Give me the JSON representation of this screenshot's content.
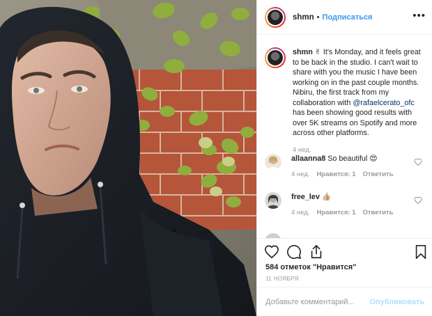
{
  "post": {
    "author": "shmn",
    "follow_separator": "•",
    "follow_label": "Подписаться",
    "more_icon": "ellipsis-icon"
  },
  "caption": {
    "author": "shmn",
    "emoji": "✌",
    "text_before": " It's Monday, and it feels great to be back in the studio. I can't wait to share with you the music I have been working on in the past couple months. Nibiru, the first track from my collaboration with ",
    "mention": "@rafaelcerato_ofc",
    "text_after": " has been showing good results with over 5K streams on Spotify and more across other platforms.",
    "time": "4 нед."
  },
  "comments": [
    {
      "author": "allaanna8",
      "text": "So beautiful 😍",
      "time": "4 нед.",
      "likes": "Нравится: 1",
      "reply": "Ответить"
    },
    {
      "author": "free_lev",
      "text": "👍🏼",
      "time": "4 нед.",
      "likes": "Нравится: 1",
      "reply": "Ответить"
    }
  ],
  "actions": {
    "likes_count": "584 отметок \"Нравится\"",
    "date": "11 НОЯБРЯ"
  },
  "add_comment": {
    "placeholder": "Добавьте комментарий...",
    "publish_label": "Опубликовать"
  },
  "colors": {
    "accent": "#3897f0",
    "muted": "#999999",
    "publish_disabled": "#b2dffc",
    "brick": "#b5553a",
    "leaf": "#8fae3e"
  }
}
